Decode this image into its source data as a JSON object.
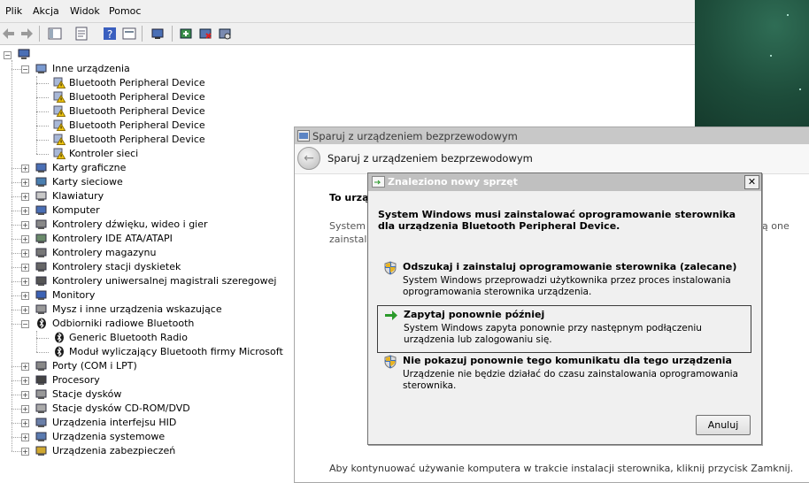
{
  "menu": [
    "Plik",
    "Akcja",
    "Widok",
    "Pomoc"
  ],
  "tree": {
    "root_label": "",
    "categories": [
      {
        "label": "Inne urządzenia",
        "expanded": true,
        "icon": "unknown-device-icon",
        "children": [
          "Bluetooth Peripheral Device",
          "Bluetooth Peripheral Device",
          "Bluetooth Peripheral Device",
          "Bluetooth Peripheral Device",
          "Bluetooth Peripheral Device",
          "Kontroler sieci"
        ]
      },
      {
        "label": "Karty graficzne",
        "icon": "display-adapter-icon"
      },
      {
        "label": "Karty sieciowe",
        "icon": "network-adapter-icon"
      },
      {
        "label": "Klawiatury",
        "icon": "keyboard-icon"
      },
      {
        "label": "Komputer",
        "icon": "computer-icon"
      },
      {
        "label": "Kontrolery dźwięku, wideo i gier",
        "icon": "sound-icon"
      },
      {
        "label": "Kontrolery IDE ATA/ATAPI",
        "icon": "ide-icon"
      },
      {
        "label": "Kontrolery magazynu",
        "icon": "storage-icon"
      },
      {
        "label": "Kontrolery stacji dyskietek",
        "icon": "floppy-icon"
      },
      {
        "label": "Kontrolery uniwersalnej magistrali szeregowej",
        "icon": "usb-icon"
      },
      {
        "label": "Monitory",
        "icon": "monitor-icon"
      },
      {
        "label": "Mysz i inne urządzenia wskazujące",
        "icon": "mouse-icon"
      },
      {
        "label": "Odbiorniki radiowe Bluetooth",
        "expanded": true,
        "icon": "bluetooth-icon",
        "children": [
          "Generic Bluetooth Radio",
          "Moduł wyliczający Bluetooth firmy Microsoft"
        ]
      },
      {
        "label": "Porty (COM i LPT)",
        "icon": "port-icon"
      },
      {
        "label": "Procesory",
        "icon": "processor-icon"
      },
      {
        "label": "Stacje dysków",
        "icon": "disk-drive-icon"
      },
      {
        "label": "Stacje dysków CD-ROM/DVD",
        "icon": "cdrom-icon"
      },
      {
        "label": "Urządzenia interfejsu HID",
        "icon": "hid-icon"
      },
      {
        "label": "Urządzenia systemowe",
        "icon": "system-device-icon"
      },
      {
        "label": "Urządzenia zabezpieczeń",
        "icon": "security-device-icon"
      }
    ]
  },
  "wizard": {
    "title": "Sparuj z urządzeniem bezprzewodowym",
    "header": "Sparuj z urządzeniem bezprzewodowym",
    "body_heading": "To urzą",
    "body_line1_start": "System W",
    "body_line1_end": "ą one",
    "body_line2_start": "zainstalo",
    "footer": "Aby kontynuować używanie komputera w trakcie instalacji sterownika, kliknij przycisk Zamknij."
  },
  "dialog": {
    "title": "Znaleziono nowy sprzęt",
    "close": "✕",
    "intro": "System Windows musi zainstalować oprogramowanie sterownika dla urządzenia Bluetooth Peripheral Device.",
    "options": [
      {
        "heading": "Odszukaj i zainstaluj oprogramowanie sterownika (zalecane)",
        "desc": "System Windows przeprowadzi użytkownika przez proces instalowania oprogramowania sterownika urządzenia.",
        "icon": "shield-icon",
        "selected": false
      },
      {
        "heading": "Zapytaj ponownie później",
        "desc": "System Windows zapyta ponownie przy następnym podłączeniu urządzenia lub zalogowaniu się.",
        "icon": "green-arrow-icon",
        "selected": true
      },
      {
        "heading": "Nie pokazuj ponownie tego komunikatu dla tego urządzenia",
        "desc": "Urządzenie nie będzie działać do czasu zainstalowania oprogramowania sterownika.",
        "icon": "shield-icon",
        "selected": false
      }
    ],
    "cancel": "Anuluj"
  },
  "colors": {
    "title_inactive": "#c0c0c0",
    "selection_border": "#3c3c3c",
    "arrow_green": "#2a9a2a",
    "warning_yellow": "#f2c811"
  }
}
